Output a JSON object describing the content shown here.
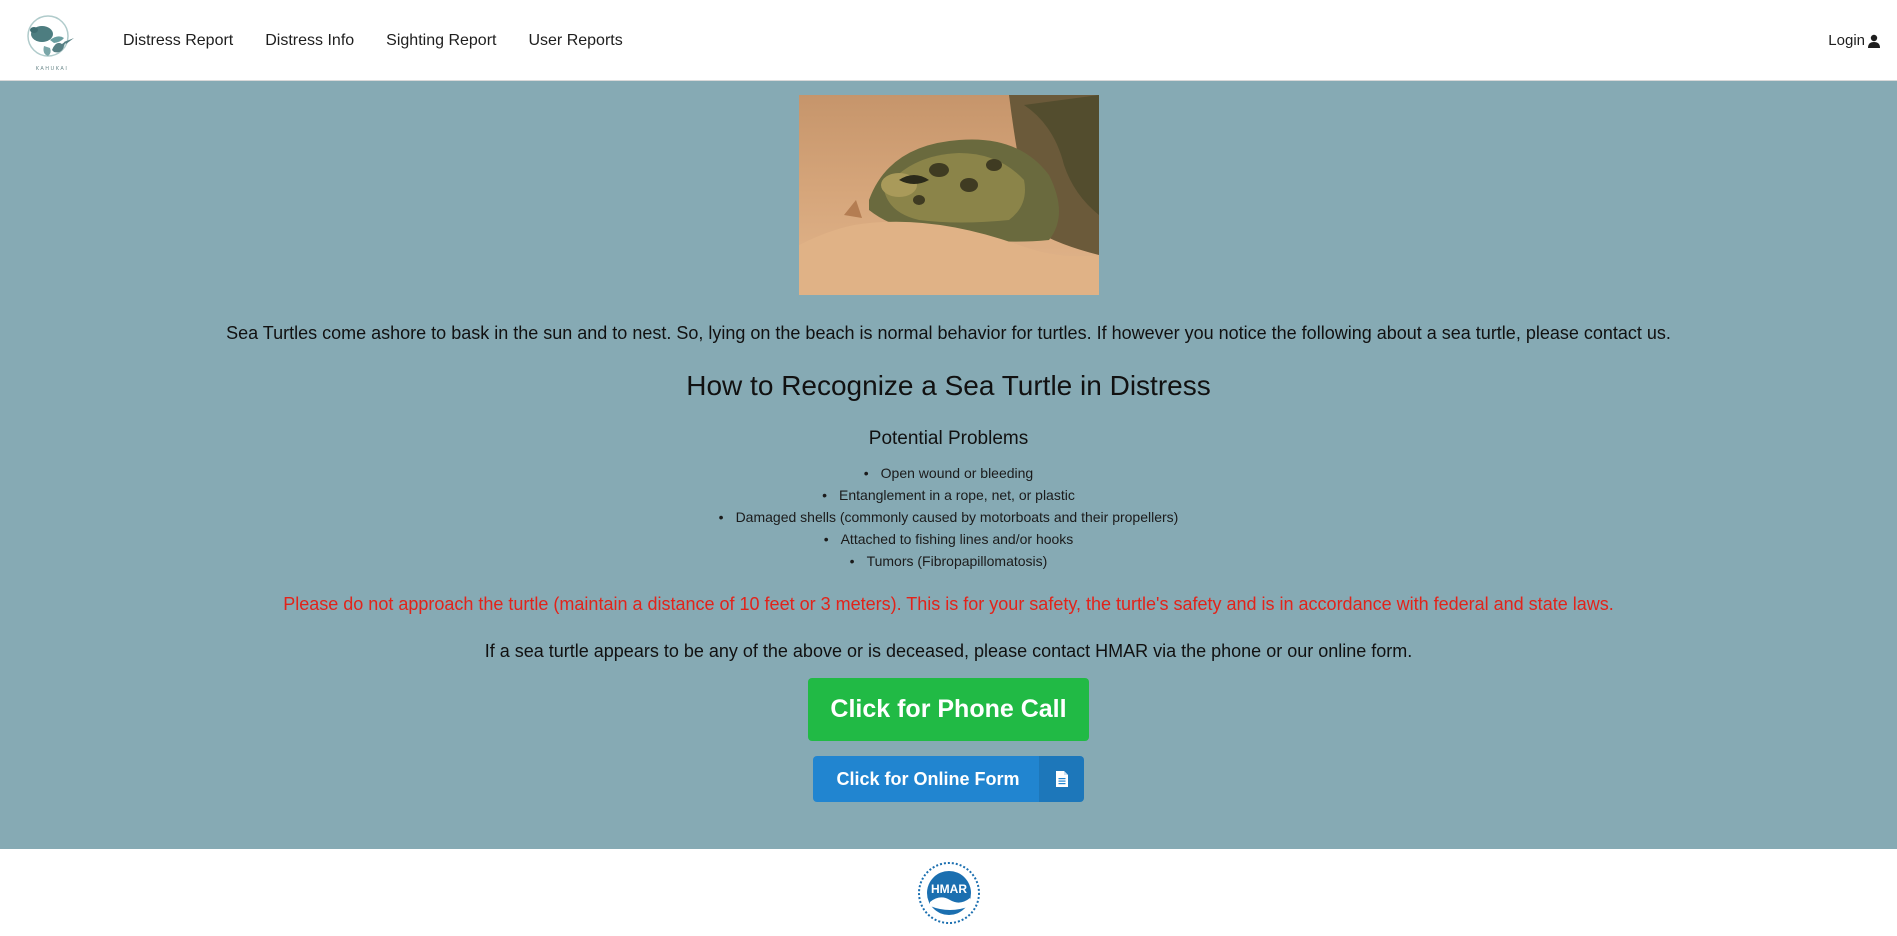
{
  "brand": {
    "logo_icon": "kahukai-turtle-bird-logo-icon",
    "logo_text": "KAHUKAI"
  },
  "nav": {
    "items": [
      {
        "label": "Distress Report"
      },
      {
        "label": "Distress Info"
      },
      {
        "label": "Sighting Report"
      },
      {
        "label": "User Reports"
      }
    ],
    "login_label": "Login",
    "login_icon": "user-icon"
  },
  "main": {
    "hero_image": "sea-turtle-on-sand-photo",
    "intro": "Sea Turtles come ashore to bask in the sun and to nest. So, lying on the beach is normal behavior for turtles. If however you notice the following about a sea turtle, please contact us.",
    "title": "How to Recognize a Sea Turtle in Distress",
    "subtitle": "Potential Problems",
    "problems": [
      "Open wound or bleeding",
      "Entanglement in a rope, net, or plastic",
      "Damaged shells (commonly caused by motorboats and their propellers)",
      "Attached to fishing lines and/or hooks",
      "Tumors (Fibropapillomatosis)"
    ],
    "warning": "Please do not approach the turtle (maintain a distance of 10 feet or 3 meters). This is for your safety, the turtle's safety and is in accordance with federal and state laws.",
    "contact": "If a sea turtle appears to be any of the above or is deceased, please contact HMAR via the phone or our online form.",
    "phone_button": "Click for Phone Call",
    "form_button": "Click for Online Form",
    "form_button_icon": "document-icon"
  },
  "footer": {
    "logo_icon": "hmar-logo-icon",
    "logo_text": "HMAR"
  },
  "colors": {
    "main_bg": "#86aab4",
    "warning": "#e2231a",
    "phone_button": "#21ba45",
    "form_button": "#2185d0"
  }
}
